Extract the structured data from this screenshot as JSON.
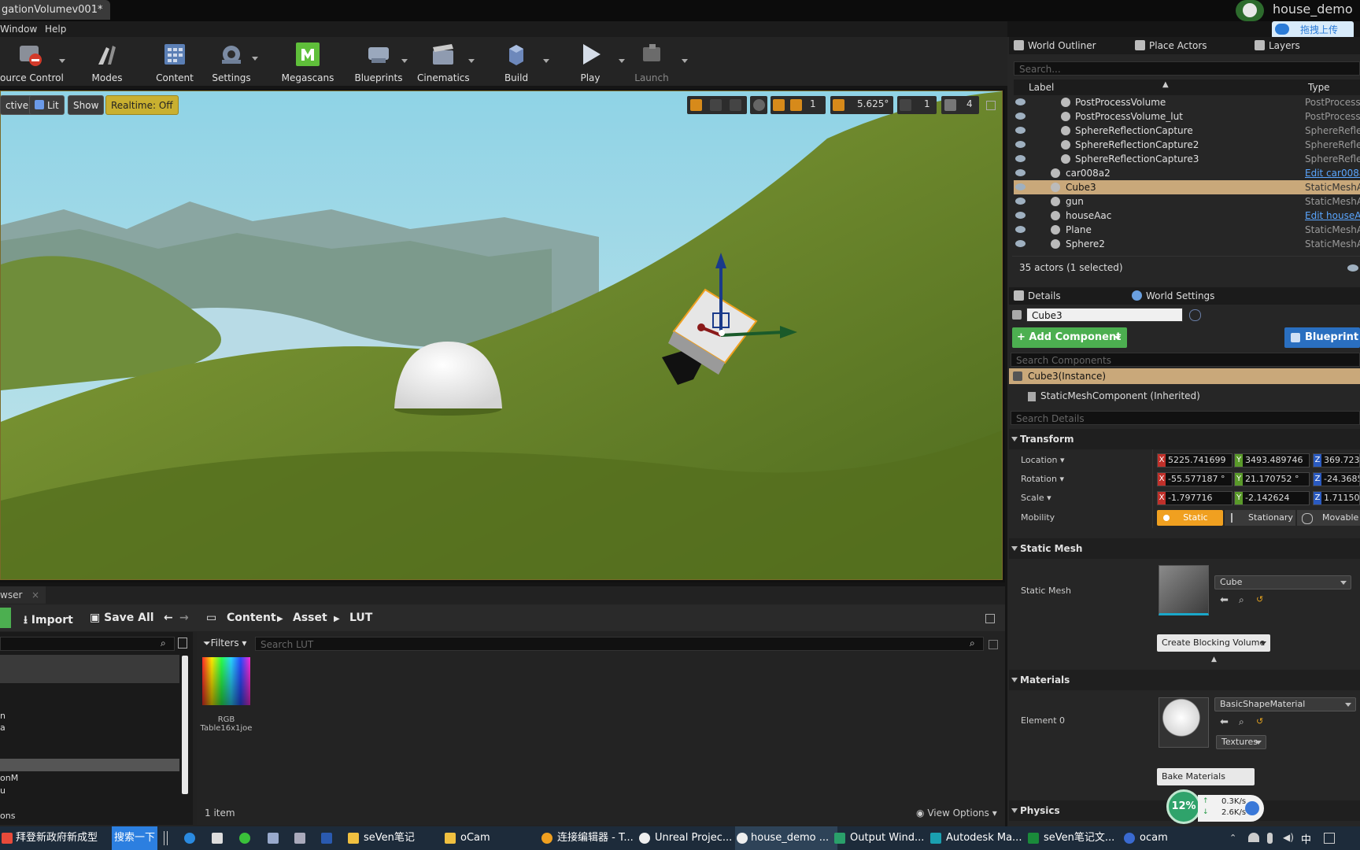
{
  "window": {
    "doc_tab": "gationVolumev001*",
    "project_name": "house_demo",
    "upload_label": "拖拽上传"
  },
  "menu": [
    "Window",
    "Help"
  ],
  "toolbar": [
    {
      "label": "ource Control",
      "icon": "source-control-icon"
    },
    {
      "label": "Modes",
      "icon": "modes-icon"
    },
    {
      "label": "Content",
      "icon": "content-icon"
    },
    {
      "label": "Settings",
      "icon": "settings-icon"
    },
    {
      "label": "Megascans",
      "icon": "megascans-icon"
    },
    {
      "label": "Blueprints",
      "icon": "blueprints-icon"
    },
    {
      "label": "Cinematics",
      "icon": "cinematics-icon"
    },
    {
      "label": "Build",
      "icon": "build-icon"
    },
    {
      "label": "Play",
      "icon": "play-icon"
    },
    {
      "label": "Launch",
      "icon": "launch-icon"
    }
  ],
  "viewport": {
    "perspective_label": "ctive",
    "lit_label": "Lit",
    "show_label": "Show",
    "realtime_label": "Realtime: Off",
    "grid_snap": "1",
    "angle_snap": "5.625°",
    "scale_snap": "1",
    "camera_speed": "4"
  },
  "outliner": {
    "tabs": [
      "World Outliner",
      "Place Actors",
      "Layers"
    ],
    "search_placeholder": "Search...",
    "col_label": "Label",
    "col_type": "Type",
    "rows": [
      {
        "name": "PostProcessVolume",
        "type": "PostProcess",
        "indent": 2,
        "link": false,
        "selected": false
      },
      {
        "name": "PostProcessVolume_lut",
        "type": "PostProcess",
        "indent": 2,
        "link": false,
        "selected": false
      },
      {
        "name": "SphereReflectionCapture",
        "type": "SphereReflec",
        "indent": 2,
        "link": false,
        "selected": false
      },
      {
        "name": "SphereReflectionCapture2",
        "type": "SphereReflec",
        "indent": 2,
        "link": false,
        "selected": false
      },
      {
        "name": "SphereReflectionCapture3",
        "type": "SphereReflec",
        "indent": 2,
        "link": false,
        "selected": false
      },
      {
        "name": "car008a2",
        "type": "Edit car008a",
        "indent": 1,
        "link": true,
        "selected": false
      },
      {
        "name": "Cube3",
        "type": "StaticMeshA",
        "indent": 1,
        "link": false,
        "selected": true
      },
      {
        "name": "gun",
        "type": "StaticMeshA",
        "indent": 1,
        "link": false,
        "selected": false
      },
      {
        "name": "houseAac",
        "type": "Edit houseA",
        "indent": 1,
        "link": true,
        "selected": false
      },
      {
        "name": "Plane",
        "type": "StaticMeshA",
        "indent": 1,
        "link": false,
        "selected": false
      },
      {
        "name": "Sphere2",
        "type": "StaticMeshA",
        "indent": 1,
        "link": false,
        "selected": false
      }
    ],
    "actor_count": "35 actors (1 selected)"
  },
  "details": {
    "tabs": [
      "Details",
      "World Settings"
    ],
    "actor_name": "Cube3",
    "add_component": "+ Add Component",
    "blueprint_label": "Blueprint",
    "search_components": "Search Components",
    "instance_label": "Cube3(Instance)",
    "component_label": "StaticMeshComponent (Inherited)",
    "search_details": "Search Details",
    "transform": {
      "title": "Transform",
      "location_label": "Location",
      "rotation_label": "Rotation",
      "scale_label": "Scale",
      "mobility_label": "Mobility",
      "location": [
        "5225.741699",
        "3493.489746",
        "369.723"
      ],
      "rotation": [
        "-55.577187 °",
        "21.170752 °",
        "-24.3685"
      ],
      "scale": [
        "-1.797716",
        "-2.142624",
        "1.71150"
      ],
      "mobility_options": [
        "Static",
        "Stationary",
        "Movable"
      ]
    },
    "static_mesh": {
      "title": "Static Mesh",
      "label": "Static Mesh",
      "value": "Cube",
      "create_blocking": "Create Blocking Volume"
    },
    "materials": {
      "title": "Materials",
      "element_label": "Element 0",
      "value": "BasicShapeMaterial",
      "textures": "Textures",
      "bake": "Bake Materials"
    },
    "physics_title": "Physics"
  },
  "content_browser": {
    "tab": "wser",
    "import": "Import",
    "save_all": "Save All",
    "breadcrumb": [
      "Content",
      "Asset",
      "LUT"
    ],
    "filters": "Filters",
    "search_placeholder": "Search LUT",
    "asset_name": "RGB\nTable16x1joe",
    "item_count": "1 item",
    "view_options": "View Options",
    "left_items": [
      "n",
      "a",
      "onM",
      "u",
      "ons"
    ]
  },
  "network": {
    "percent": "12%",
    "up": "0.3K/s",
    "down": "2.6K/s"
  },
  "taskbar": {
    "items": [
      "拜登新政府新成型",
      "搜索一下",
      "seVen笔记",
      "oCam",
      "连接编辑器 - T...",
      "Unreal Projec...",
      "house_demo ...",
      "Output Wind...",
      "Autodesk Ma...",
      "seVen笔记文...",
      "ocam"
    ],
    "ime": "中"
  }
}
